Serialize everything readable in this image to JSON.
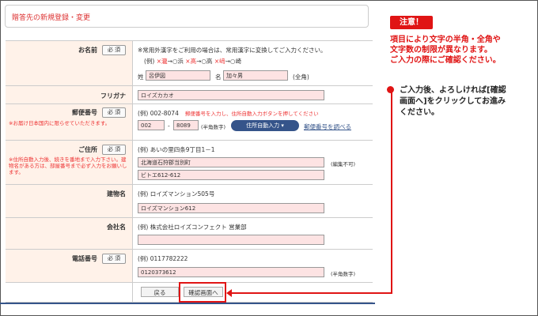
{
  "page_title": "贈答先の新規登録・変更",
  "required_label": "必 須",
  "name": {
    "label": "お名前",
    "note": "※常用外漢字をご利用の場合は、常用漢字に変換してご入力ください。",
    "example_prefix": "(例)",
    "example1_bad": "×瀧",
    "example1_good": "→○浜",
    "example2_bad": "×髙",
    "example2_good": "→○高",
    "example3_bad": "×﨑",
    "example3_good": "→○崎",
    "last_label": "姓",
    "last_value": "呂伊図",
    "first_label": "名",
    "first_value": "加々男",
    "suffix": "(全角)"
  },
  "kana": {
    "label": "フリガナ",
    "value": "ロイズカカオ"
  },
  "postal": {
    "label": "郵便番号",
    "note_red": "※お届け日本国内に限らせていただきます。",
    "example": "(例) 002-8074",
    "hint_red": "郵便番号を入力し、住所自動入力ボタンを押してください",
    "value1": "002",
    "dash": "-",
    "value2": "8089",
    "suffix": "(半角数字)",
    "auto_button": "住所自動入力 ▾",
    "lookup_link": "郵便番号を調べる"
  },
  "address": {
    "label": "ご住所",
    "note_red": "※住所自動入力後、続きを番地まで入力下さい。建物名がある方は、部屋番号まで必ず入力をお願いします。",
    "example": "(例) あいの里四条9丁目1－1",
    "line1": "北海道石狩郡当別町",
    "line1_suffix": "(編集不可)",
    "line2": "ビトエ612-612"
  },
  "building": {
    "label": "建物名",
    "example": "(例) ロイズマンション505号",
    "value": "ロイズマンション612"
  },
  "company": {
    "label": "会社名",
    "example": "(例) 株式会社ロイズコンフェクト 営業部",
    "value": ""
  },
  "phone": {
    "label": "電話番号",
    "example": "(例) 0117782222",
    "value": "0120373612",
    "suffix": "(半角数字)"
  },
  "buttons": {
    "back": "戻る",
    "confirm": "確認画面へ"
  },
  "sidebar": {
    "caution": "注意！",
    "red_lines": [
      "項目により文字の半角・全角や",
      "文字数の制限が異なります。",
      "ご入力の際にご確認ください。"
    ],
    "instruction_lines": [
      "ご入力後、よろしければ[確認",
      "画面へ]をクリックしてお進み",
      "ください。"
    ]
  },
  "colors": {
    "accent_red": "#e01414",
    "label_bg": "#fff2e9",
    "input_bg": "#fde3e3",
    "button_blue": "#35548a"
  }
}
